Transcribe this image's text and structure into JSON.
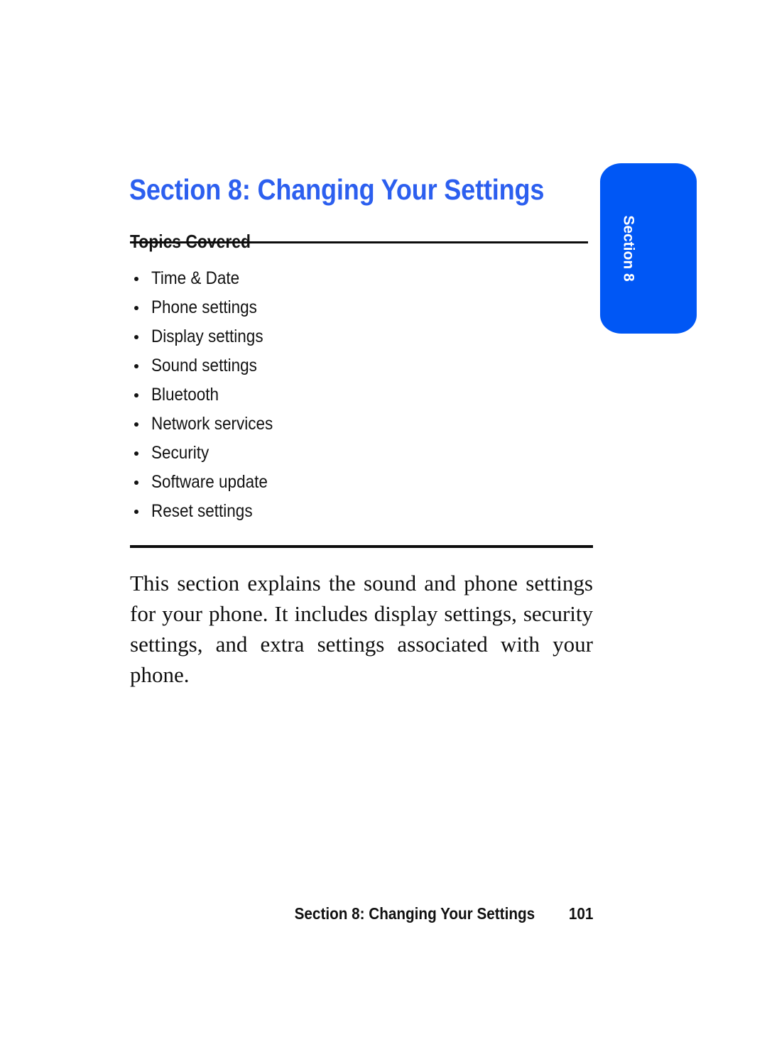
{
  "document": {
    "page_number": "101",
    "title": "Section 8: Changing Your Settings",
    "accent_color": "#2C5FEF",
    "tab_color": "#0057F5"
  },
  "header": {
    "section_title": "Section 8: Changing Your Settings"
  },
  "topics": {
    "heading": "Topics Covered",
    "items": [
      {
        "label": "Time & Date"
      },
      {
        "label": "Phone settings"
      },
      {
        "label": "Display settings"
      },
      {
        "label": "Sound settings"
      },
      {
        "label": "Bluetooth"
      },
      {
        "label": "Network services"
      },
      {
        "label": "Security"
      },
      {
        "label": "Software update"
      },
      {
        "label": "Reset settings"
      }
    ]
  },
  "body": {
    "intro_paragraph": "This section explains the sound and phone settings for your phone. It includes display settings, security settings, and extra settings associated with your phone."
  },
  "side_tab": {
    "label": "Section 8"
  },
  "footer": {
    "title": "Section 8: Changing Your Settings",
    "page_number": "101"
  }
}
